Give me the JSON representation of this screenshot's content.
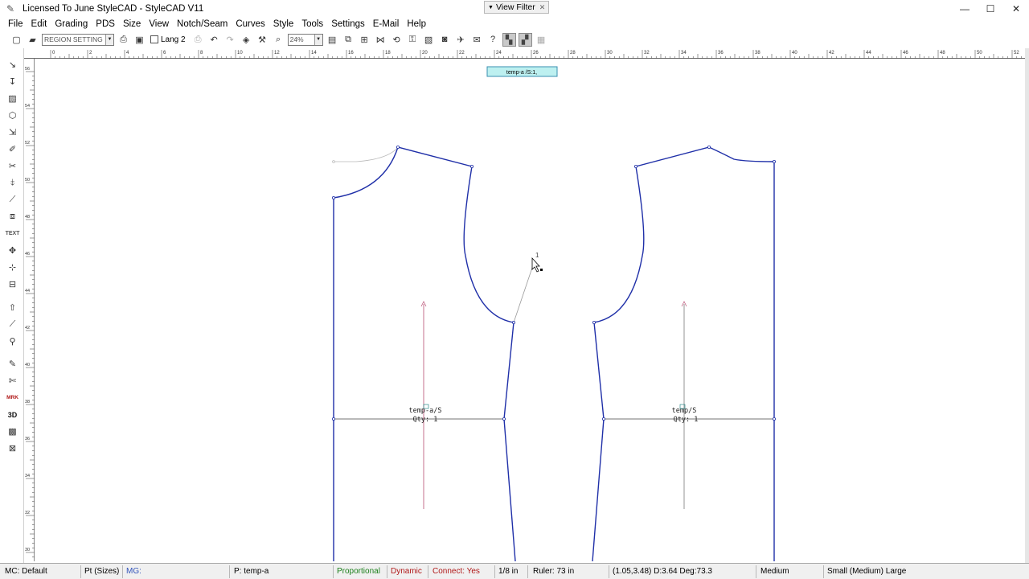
{
  "window": {
    "title": "Licensed To June StyleCAD - StyleCAD V11",
    "view_filter": "View Filter",
    "controls": {
      "minimize": "—",
      "maximize": "☐",
      "close": "✕"
    }
  },
  "menu": {
    "items": [
      "File",
      "Edit",
      "Grading",
      "PDS",
      "Size",
      "View",
      "Notch/Seam",
      "Curves",
      "Style",
      "Tools",
      "Settings",
      "E-Mail",
      "Help"
    ]
  },
  "toolbar": {
    "region_select": "REGION SETTING",
    "lang_label": "Lang 2",
    "zoom_select": "24%"
  },
  "ruler": {
    "h_labels": [
      "0",
      "2",
      "4",
      "6",
      "8",
      "10",
      "12",
      "14",
      "16",
      "18",
      "20",
      "22",
      "24",
      "26",
      "28",
      "30",
      "32",
      "34",
      "36",
      "38",
      "40",
      "42",
      "44",
      "46",
      "48",
      "50",
      "52"
    ],
    "v_labels": [
      "56",
      "54",
      "52",
      "50",
      "48",
      "46",
      "44",
      "42",
      "40",
      "38",
      "36",
      "34",
      "32",
      "30"
    ]
  },
  "canvas": {
    "piece_tag": "temp-a /S:1,",
    "piece_left": {
      "name": "temp-a/S",
      "qty": "Qty: 1"
    },
    "piece_right": {
      "name": "temp/S",
      "qty": "Qty: 1"
    },
    "cursor_point": "1"
  },
  "status": {
    "mc": "MC: Default",
    "pt": "Pt (Sizes)",
    "mg": "MG:",
    "piece": "P: temp-a",
    "proportional": "Proportional",
    "dynamic": "Dynamic",
    "connect": "Connect: Yes",
    "fraction": "1/8 in",
    "ruler": "Ruler: 73 in",
    "coords": "(1.05,3.48)  D:3.64  Deg:73.3",
    "size": "Medium",
    "size_range": "Small (Medium) Large"
  },
  "colors": {
    "pattern_line": "#1f2fa8",
    "grain_line": "#c06080",
    "status_green": "#1a7f1a",
    "status_red": "#b01818",
    "tag_fill": "#bdf0f0"
  }
}
